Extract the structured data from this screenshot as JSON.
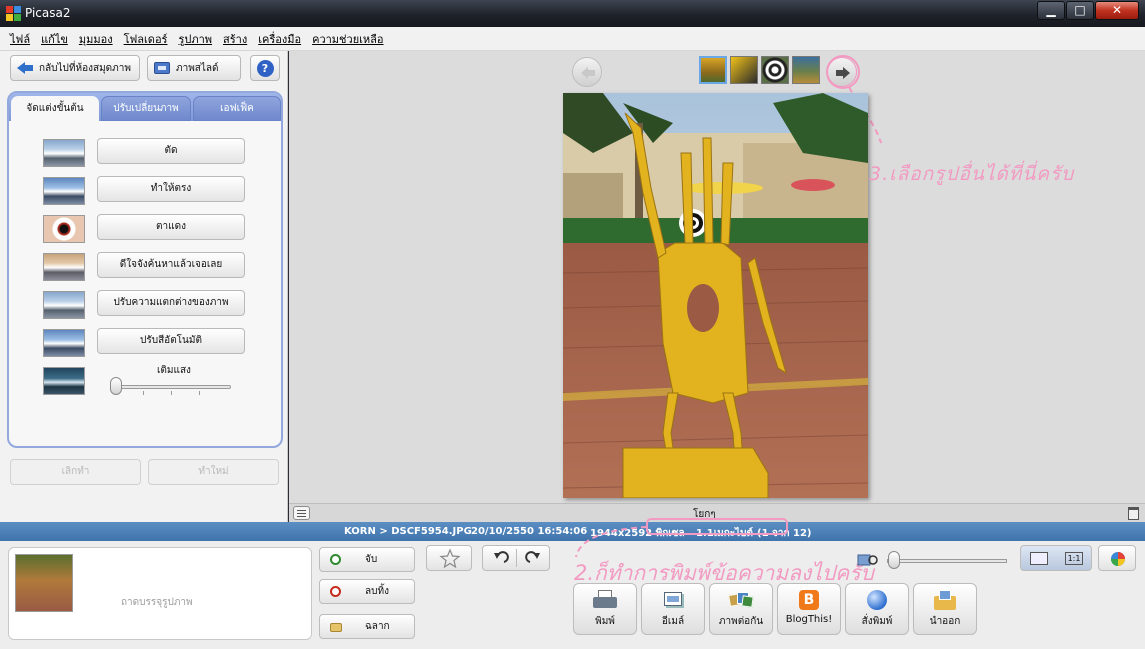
{
  "window": {
    "title": "Picasa2",
    "minimize": "▁",
    "maximize": "□",
    "close": "✕"
  },
  "menu": [
    "ไฟล์",
    "แก้ไข",
    "มุมมอง",
    "โฟลเดอร์",
    "รูปภาพ",
    "สร้าง",
    "เครื่องมือ",
    "ความช่วยเหลือ"
  ],
  "left": {
    "back_label": "กลับไปที่ห้องสมุดภาพ",
    "slideshow_label": "ภาพสไลด์",
    "help_label": "?",
    "tabs": [
      "จัดแต่งขั้นต้น",
      "ปรับเปลี่ยนภาพ",
      "เอฟเฟ็ค"
    ],
    "tools": [
      "ตัด",
      "ทำให้ตรง",
      "ตาแดง",
      "ดีใจจังค้นหาแล้วเจอเลย",
      "ปรับความแตกต่างของภาพ",
      "ปรับสีอัตโนมัติ"
    ],
    "fill_light_label": "เติมแสง",
    "undo_label": "เลิกทำ",
    "redo_label": "ทำใหม่"
  },
  "main": {
    "annotation_pick": "3.เลือกรูปอื่นได้ที่นี่ครับ",
    "caption": "โยกๆ"
  },
  "info": {
    "path": "KORN > DSCF5954.JPG",
    "datetime": "20/10/2550 16:54:06",
    "dimensions": "1944x2592 พิกเซล",
    "filesize": "1.1เมกะไบต์",
    "position": "(1 จาก 12)"
  },
  "bottom": {
    "tray_label": "ถาดบรรจุรูปภาพ",
    "hold_label": "จับ",
    "clear_label": "ลบทิ้ง",
    "label_label": "ฉลาก",
    "annotation_caption": "2.ก็ทำการพิมพ์ข้อความลงไปครับ",
    "actions": [
      "พิมพ์",
      "อีเมล์",
      "ภาพต่อกัน",
      "BlogThis!",
      "สั่งพิมพ์",
      "นำออก"
    ],
    "fit_label": "",
    "actual_size_label": "1:1"
  },
  "colors": {
    "accent": "#4a7fbd",
    "annotation": "#f29ac2",
    "photo_yellow": "#e3b21f"
  }
}
